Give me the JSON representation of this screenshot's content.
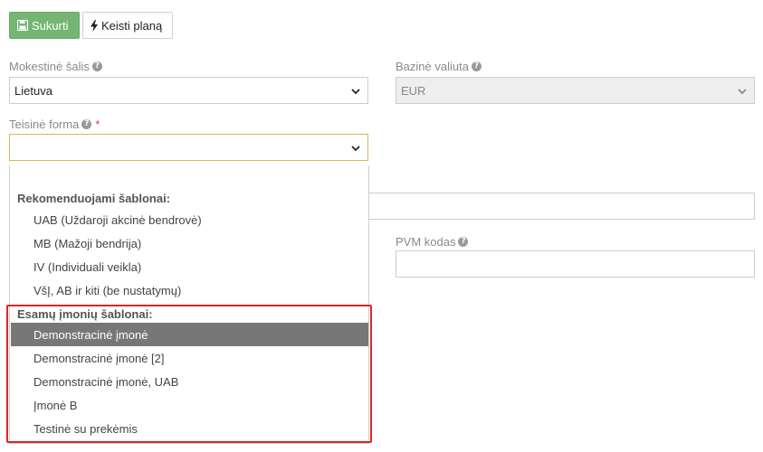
{
  "toolbar": {
    "save_label": "Sukurti",
    "plan_label": "Keisti planą"
  },
  "tax_country": {
    "label": "Mokestinė šalis",
    "value": "Lietuva"
  },
  "base_currency": {
    "label": "Bazinė valiuta",
    "value": "EUR"
  },
  "legal_form": {
    "label": "Teisinė forma",
    "required_mark": "*",
    "value": ""
  },
  "vat_code": {
    "label": "PVM kodas",
    "value": ""
  },
  "dropdown": {
    "groups": [
      {
        "label": "Rekomenduojami šablonai:",
        "options": [
          "UAB (Uždaroji akcinė bendrovė)",
          "MB (Mažoji bendrija)",
          "IV (Individuali veikla)",
          "VšĮ, AB ir kiti (be nustatymų)"
        ]
      },
      {
        "label": "Esamų įmonių šablonai:",
        "options": [
          "Demonstracinė įmonė",
          "Demonstracinė įmonė [2]",
          "Demonstracinė įmonė, UAB",
          "Įmonė B",
          "Testinė su prekėmis"
        ]
      }
    ],
    "selected": "Demonstracinė įmonė"
  },
  "colors": {
    "save_button": "#74b672",
    "selected_option": "#777777",
    "highlight_border": "#e02424",
    "focus_border": "#e0b25a",
    "required": "#d83a3a"
  },
  "icons": {
    "save": "floppy-disk-icon",
    "plan": "lightning-bolt-icon",
    "help": "question-circle-icon",
    "dropdown": "chevron-down-icon"
  }
}
